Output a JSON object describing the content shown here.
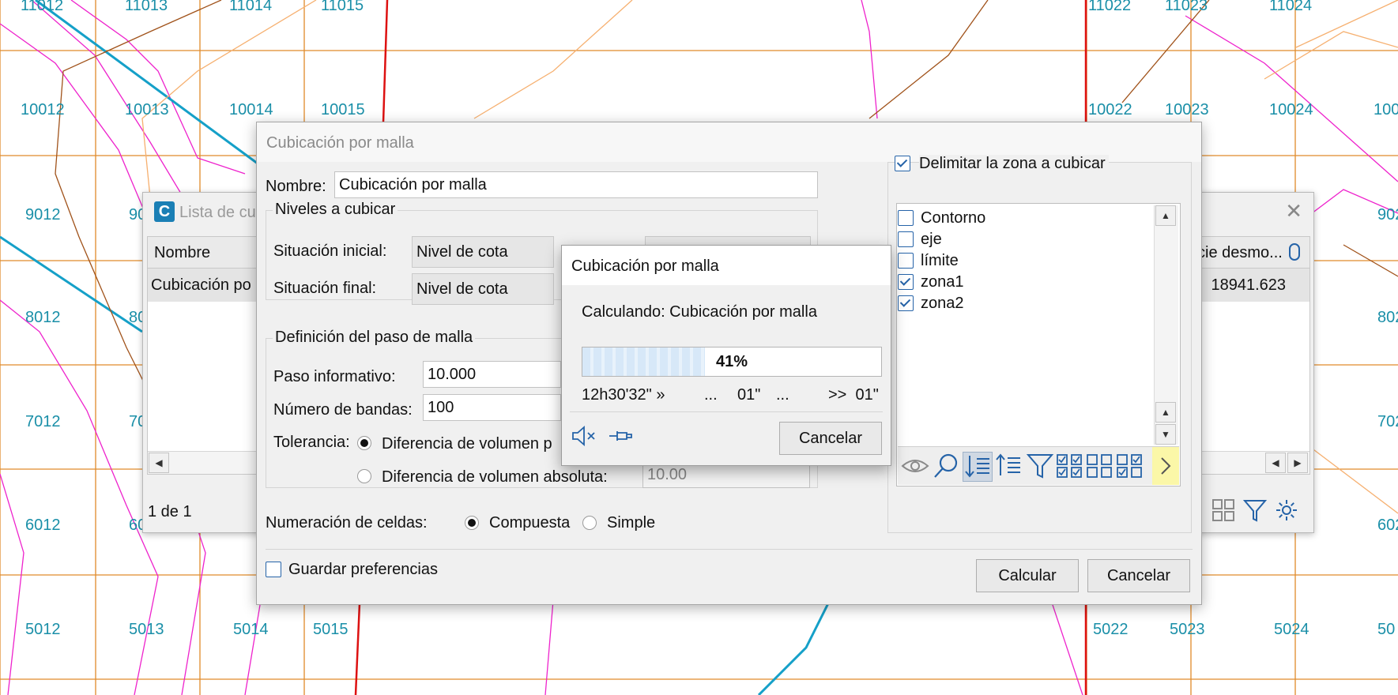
{
  "map": {
    "grid_labels": [
      "11012",
      "11013",
      "11014",
      "11015",
      "11022",
      "11023",
      "11024",
      "10012",
      "10013",
      "10014",
      "10015",
      "10022",
      "10023",
      "10024",
      "100",
      "9012",
      "90",
      "902",
      "8012",
      "80",
      "802",
      "7012",
      "70",
      "702",
      "6012",
      "60",
      "602",
      "5012",
      "5013",
      "5014",
      "5015",
      "5022",
      "5023",
      "5024",
      "50"
    ],
    "colors": {
      "grid": "#e08a2a",
      "pink": "#ee22cc",
      "cyan": "#15a0c8",
      "red": "#dd1111",
      "brown": "#a0521a",
      "label": "#1a8fa8"
    }
  },
  "list_window": {
    "app_icon_letter": "C",
    "title": "Lista de cu",
    "columns": [
      "Nombre",
      "cie desmo..."
    ],
    "rows": [
      {
        "name": "Cubicación po",
        "value": "18941.623"
      }
    ],
    "pager": "1 de 1"
  },
  "dialog": {
    "title": "Cubicación por malla",
    "name_label": "Nombre:",
    "name_value": "Cubicación por malla",
    "levels": {
      "legend": "Niveles a cubicar",
      "initial_label": "Situación inicial:",
      "initial_value": "Nivel de cota",
      "final_label": "Situación final:",
      "final_value": "Nivel de cota"
    },
    "grid_step": {
      "legend": "Definición del paso de malla",
      "step_label": "Paso informativo:",
      "step_value": "10.000",
      "bands_label": "Número de bandas:",
      "bands_value": "100",
      "tolerance_label": "Tolerancia:",
      "tol_option1": "Diferencia de volumen p",
      "tol_option2": "Diferencia de volumen absoluta:",
      "tol_value": "10.00"
    },
    "numbering": {
      "label": "Numeración de celdas:",
      "opt1": "Compuesta",
      "opt2": "Simple"
    },
    "save_prefs": "Guardar preferencias",
    "calc_button": "Calcular",
    "cancel_button": "Cancelar",
    "zone": {
      "label": "Delimitar la zona a cubicar",
      "checked": true,
      "items": [
        {
          "label": "Contorno",
          "checked": false
        },
        {
          "label": "eje",
          "checked": false
        },
        {
          "label": "límite",
          "checked": false
        },
        {
          "label": "zona1",
          "checked": true
        },
        {
          "label": "zona2",
          "checked": true
        }
      ]
    }
  },
  "progress": {
    "title": "Cubicación por malla",
    "message": "Calculando: Cubicación por malla",
    "percent_value": 0.41,
    "percent_text": "41%",
    "start_time": "12h30'32\" »",
    "dots1": "...",
    "elapsed": "01\"",
    "dots2": "...",
    "remaining": ">>  01\"",
    "cancel": "Cancelar"
  }
}
